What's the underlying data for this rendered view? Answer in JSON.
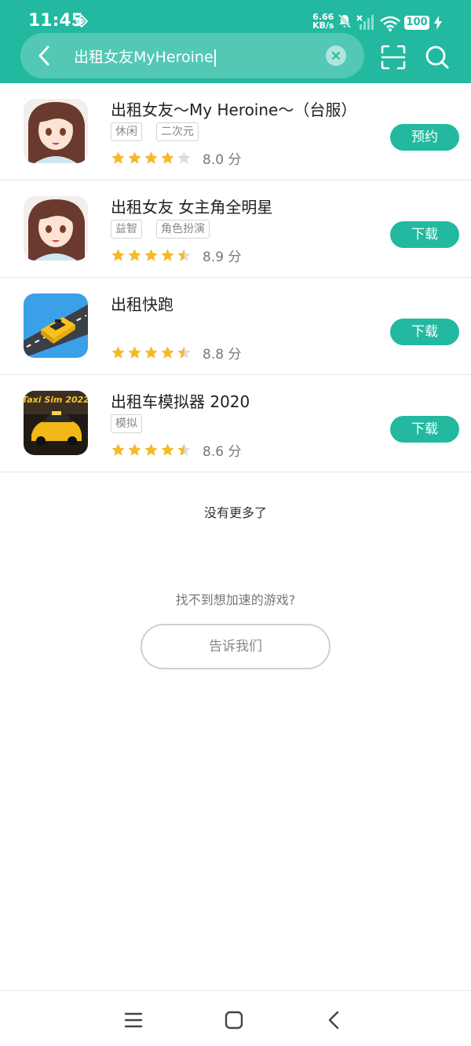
{
  "status_bar": {
    "time": "11:45",
    "speed_value": "6.66",
    "speed_unit": "KB/s",
    "battery": "100"
  },
  "search": {
    "query": "出租女友MyHeroine"
  },
  "results": [
    {
      "title": "出租女友～My Heroine～（台服）",
      "tags": [
        "休闲",
        "二次元"
      ],
      "stars": 4,
      "score": "8.0 分",
      "action": "预约",
      "icon": "anime-girl-icon"
    },
    {
      "title": "出租女友 女主角全明星",
      "tags": [
        "益智",
        "角色扮演"
      ],
      "stars": 4.5,
      "score": "8.9 分",
      "action": "下载",
      "icon": "anime-girl-icon"
    },
    {
      "title": "出租快跑",
      "tags": [],
      "stars": 4.5,
      "score": "8.8 分",
      "action": "下载",
      "icon": "taxi-car-icon"
    },
    {
      "title": "出租车模拟器 2020",
      "tags": [
        "模拟"
      ],
      "stars": 4.5,
      "score": "8.6 分",
      "action": "下载",
      "icon": "taxi-sim-icon",
      "icon_text": "Taxi Sim 2022"
    }
  ],
  "footer": {
    "no_more": "没有更多了",
    "not_found": "找不到想加速的游戏?",
    "tell_us": "告诉我们"
  },
  "colors": {
    "brand": "#22b9a0",
    "star": "#f7b928",
    "star_empty": "#dddddd"
  }
}
